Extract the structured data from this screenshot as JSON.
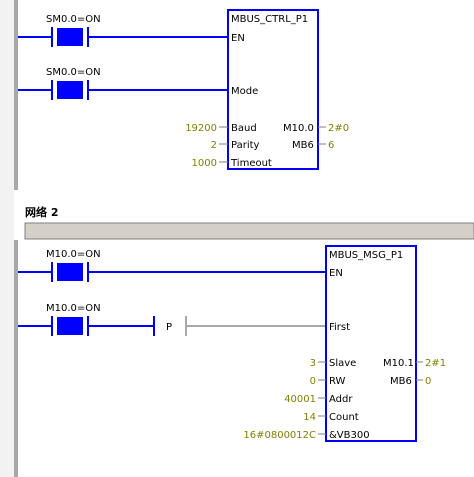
{
  "networks": [
    {
      "contacts": [
        "SM0.0=ON",
        "SM0.0=ON"
      ],
      "block": {
        "name": "MBUS_CTRL_P1",
        "pins_left": [
          "EN",
          "Mode",
          "Baud",
          "Parity",
          "Timeout"
        ],
        "pins_right": [
          "M10.0",
          "MB6"
        ],
        "inputs": {
          "baud": "19200",
          "parity": "2",
          "timeout": "1000"
        },
        "outputs": {
          "m10_0": "2#0",
          "mb6": "6"
        }
      }
    },
    {
      "title": "网络 2",
      "contacts": [
        "M10.0=ON",
        "M10.0=ON"
      ],
      "p_label": "P",
      "block": {
        "name": "MBUS_MSG_P1",
        "pins_left": [
          "EN",
          "First",
          "Slave",
          "RW",
          "Addr",
          "Count",
          "&VB300"
        ],
        "pins_right": [
          "M10.1",
          "MB6"
        ],
        "inputs": {
          "slave": "3",
          "rw": "0",
          "addr": "40001",
          "count": "14",
          "dataptr": "16#0800012C"
        },
        "outputs": {
          "m10_1": "2#1",
          "mb6": "0"
        }
      }
    }
  ],
  "colors": {
    "wire": "#0000ff",
    "contact_fill": "#0000ff",
    "status_text": "#808000",
    "power_rail": "#a0a0a0",
    "separator": "#d4d0c8"
  }
}
